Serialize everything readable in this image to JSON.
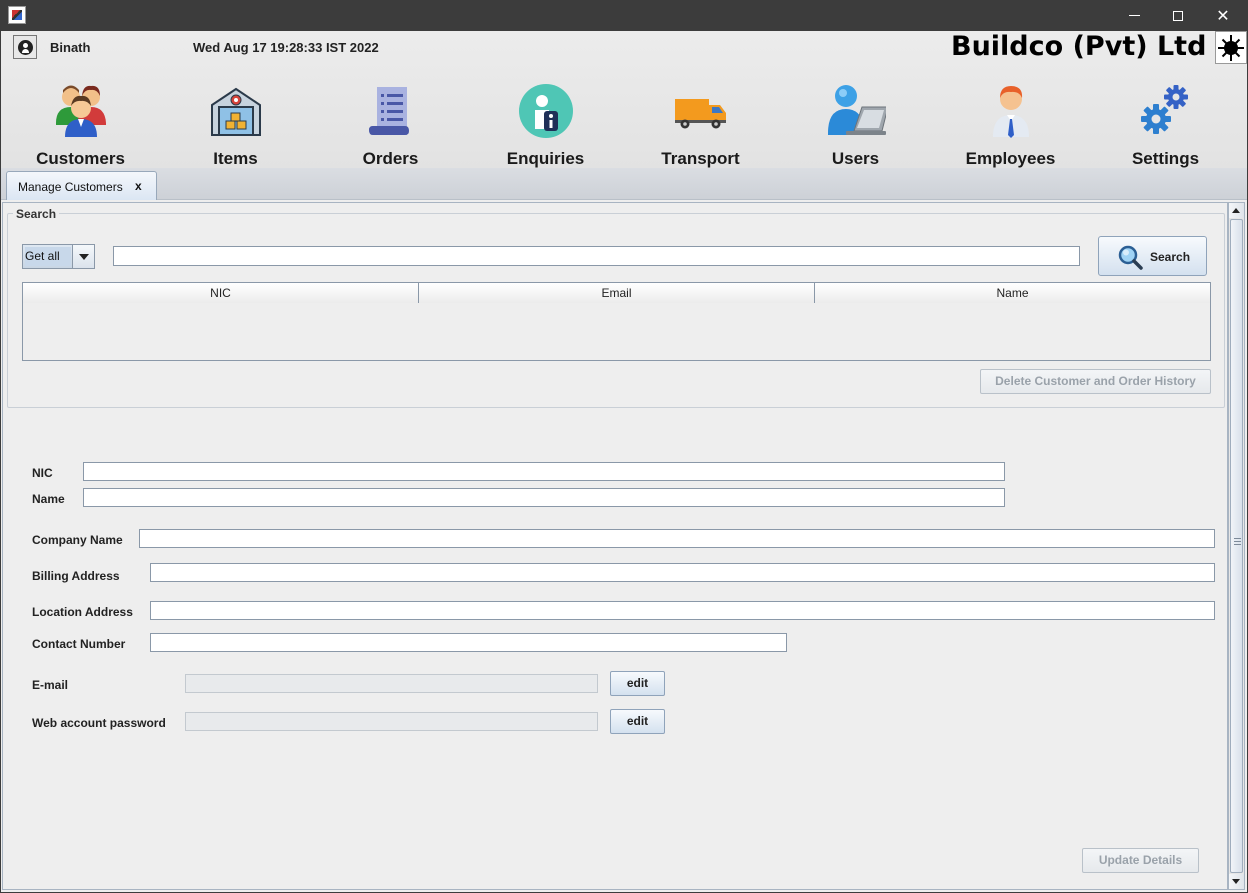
{
  "header": {
    "username": "Binath",
    "datetime": "Wed Aug 17 19:28:33 IST 2022",
    "company": "Buildco (Pvt) Ltd"
  },
  "nav": {
    "items": [
      {
        "label": "Customers",
        "icon": "customers-icon"
      },
      {
        "label": "Items",
        "icon": "warehouse-icon"
      },
      {
        "label": "Orders",
        "icon": "document-icon"
      },
      {
        "label": "Enquiries",
        "icon": "info-person-icon"
      },
      {
        "label": "Transport",
        "icon": "truck-icon"
      },
      {
        "label": "Users",
        "icon": "user-laptop-icon"
      },
      {
        "label": "Employees",
        "icon": "employee-icon"
      },
      {
        "label": "Settings",
        "icon": "gears-icon"
      }
    ]
  },
  "tab": {
    "label": "Manage Customers",
    "close": "x"
  },
  "search": {
    "legend": "Search",
    "filter_value": "Get all",
    "query": "",
    "button_label": "Search",
    "columns": [
      "NIC",
      "Email",
      "Name"
    ],
    "rows": [],
    "delete_label": "Delete Customer and Order History"
  },
  "form": {
    "nic_label": "NIC",
    "name_label": "Name",
    "company_label": "Company Name",
    "billing_label": "Billing Address",
    "location_label": "Location Address",
    "contact_label": "Contact Number",
    "email_label": "E-mail",
    "password_label": "Web account password",
    "edit_label": "edit",
    "update_label": "Update Details"
  }
}
